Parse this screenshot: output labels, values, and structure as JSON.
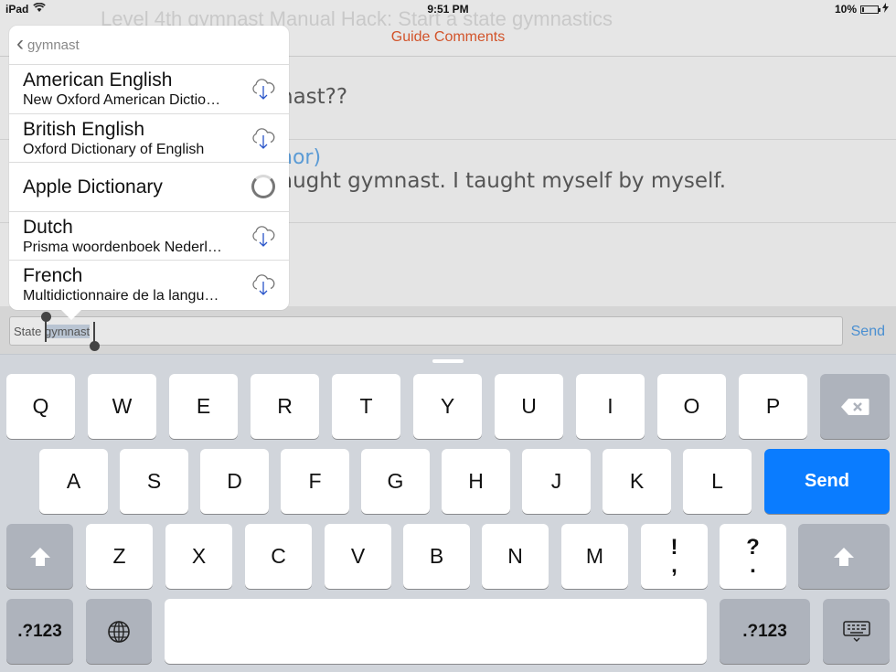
{
  "status_bar": {
    "device": "iPad",
    "time": "9:51 PM",
    "battery": "10%",
    "battery_level": 0.1
  },
  "header": {
    "ghost_title": "Level 4th gymnast Manual Hack: Start a state gymnastics",
    "title": "Guide Comments"
  },
  "comments": [
    {
      "text": "nast??"
    },
    {
      "author": "nor)",
      "text": "aught gymnast.  I taught myself by myself."
    }
  ],
  "compose": {
    "prefix": "State ",
    "selected": "gymnast",
    "send_label": "Send"
  },
  "popover": {
    "back_label": "gymnast",
    "rows": [
      {
        "name": "American English",
        "subtitle": "New Oxford American Dictio…",
        "state": "download"
      },
      {
        "name": "British English",
        "subtitle": "Oxford Dictionary of English",
        "state": "download"
      },
      {
        "name": "Apple Dictionary",
        "subtitle": "",
        "state": "loading"
      },
      {
        "name": "Dutch",
        "subtitle": "Prisma woordenboek Nederl…",
        "state": "download"
      },
      {
        "name": "French",
        "subtitle": "Multidictionnaire de la langu…",
        "state": "download"
      }
    ]
  },
  "keyboard": {
    "row1": [
      "Q",
      "W",
      "E",
      "R",
      "T",
      "Y",
      "U",
      "I",
      "O",
      "P"
    ],
    "row2": [
      "A",
      "S",
      "D",
      "F",
      "G",
      "H",
      "J",
      "K",
      "L"
    ],
    "return_label": "Send",
    "row3": [
      "Z",
      "X",
      "C",
      "V",
      "B",
      "N",
      "M"
    ],
    "punct1": [
      "!",
      ","
    ],
    "punct2": [
      "?",
      "."
    ],
    "numbers_label": ".?123",
    "icons": {
      "delete": "delete-icon",
      "shift": "shift-icon",
      "globe": "globe-icon",
      "dismiss": "keyboard-dismiss-icon"
    }
  }
}
